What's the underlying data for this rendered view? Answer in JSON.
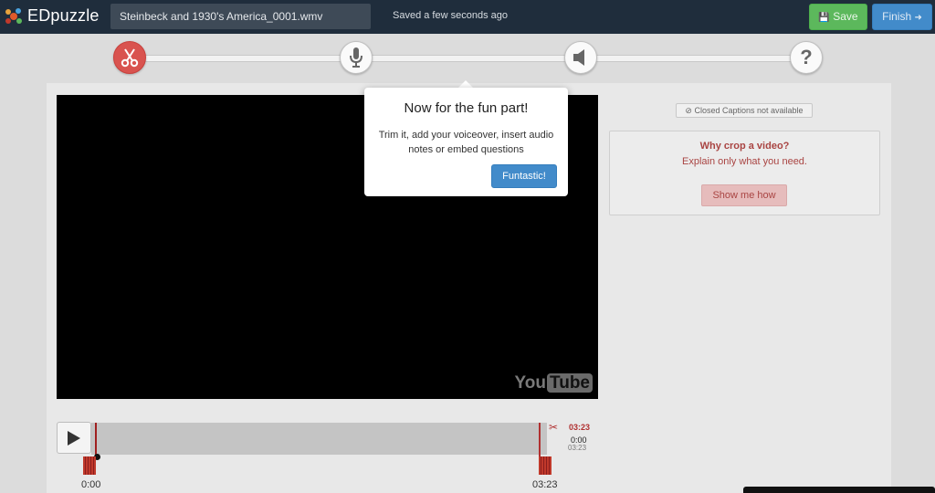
{
  "header": {
    "brand": "EDpuzzle",
    "video_title": "Steinbeck and 1930's America_0001.wmv",
    "save_status": "Saved a few seconds ago",
    "save_label": "Save",
    "finish_label": "Finish",
    "accent_save": "#5cb85c",
    "accent_finish": "#428bca"
  },
  "steps": [
    {
      "icon": "scissors-icon",
      "active": true
    },
    {
      "icon": "microphone-icon",
      "active": false
    },
    {
      "icon": "speaker-icon",
      "active": false
    },
    {
      "icon": "question-icon",
      "label": "?",
      "active": false
    }
  ],
  "video": {
    "watermark_left": "You",
    "watermark_right": "Tube"
  },
  "captions": {
    "status": "Closed Captions not available"
  },
  "tip": {
    "title": "Why crop a video?",
    "subtitle": "Explain only what you need.",
    "button_label": "Show me how"
  },
  "popover": {
    "title": "Now for the fun part!",
    "body": "Trim it, add your voiceover, insert audio notes or embed questions",
    "button_label": "Funtastic!"
  },
  "timeline": {
    "start_time": "0:00",
    "end_time": "03:23",
    "crop_end": "03:23",
    "current_time": "0:00",
    "duration": "03:23"
  }
}
